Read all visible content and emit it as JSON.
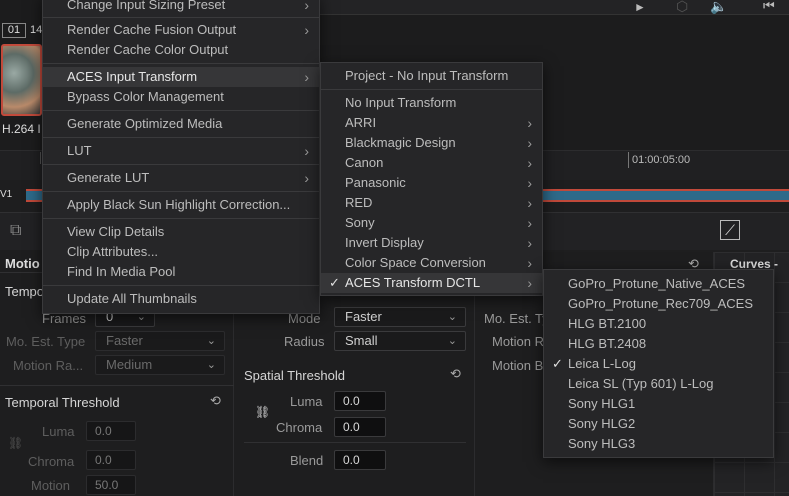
{
  "top_bar": {
    "frame_box": "01",
    "frame_box_partial": "14",
    "clip_caption": "H.264 I",
    "controls": [
      "play-icon",
      "cube-icon",
      "speaker-icon",
      "skip-back-icon"
    ]
  },
  "timeline": {
    "timecode": "01:00:05:00",
    "track_label": "V1"
  },
  "context_menu": {
    "items": [
      {
        "label": "Change Input Sizing Preset",
        "submenu": true
      },
      {
        "label": "Render Cache Fusion Output",
        "submenu": true
      },
      {
        "label": "Render Cache Color Output"
      },
      {
        "label": "ACES Input Transform",
        "submenu": true,
        "highlighted": true
      },
      {
        "label": "Bypass Color Management"
      },
      {
        "label": "Generate Optimized Media"
      },
      {
        "label": "LUT",
        "submenu": true
      },
      {
        "label": "Generate LUT",
        "submenu": true
      },
      {
        "label": "Apply Black Sun Highlight Correction..."
      },
      {
        "label": "View Clip Details"
      },
      {
        "label": "Clip Attributes..."
      },
      {
        "label": "Find In Media Pool"
      },
      {
        "label": "Update All Thumbnails"
      }
    ]
  },
  "aces_submenu": {
    "items": [
      {
        "label": "Project - No Input Transform"
      },
      {
        "label": "No Input Transform"
      },
      {
        "label": "ARRI",
        "submenu": true
      },
      {
        "label": "Blackmagic Design",
        "submenu": true
      },
      {
        "label": "Canon",
        "submenu": true
      },
      {
        "label": "Panasonic",
        "submenu": true
      },
      {
        "label": "RED",
        "submenu": true
      },
      {
        "label": "Sony",
        "submenu": true
      },
      {
        "label": "Invert Display",
        "submenu": true
      },
      {
        "label": "Color Space Conversion",
        "submenu": true
      },
      {
        "label": "ACES Transform DCTL",
        "submenu": true,
        "checked": true,
        "highlighted": true
      }
    ]
  },
  "dctl_submenu": {
    "items": [
      {
        "label": "GoPro_Protune_Native_ACES"
      },
      {
        "label": "GoPro_Protune_Rec709_ACES"
      },
      {
        "label": "HLG BT.2100"
      },
      {
        "label": "HLG BT.2408"
      },
      {
        "label": "Leica L-Log",
        "checked": true
      },
      {
        "label": "Leica SL (Typ 601) L-Log"
      },
      {
        "label": "Sony HLG1"
      },
      {
        "label": "Sony HLG2"
      },
      {
        "label": "Sony HLG3"
      }
    ]
  },
  "left_panel": {
    "title": "Motio",
    "section": "Tempo",
    "frames_label": "Frames",
    "frames_value": "0",
    "mo_est_label": "Mo. Est. Type",
    "mo_est_value": "Faster",
    "motion_range_label": "Motion Ra...",
    "motion_range_value": "Medium",
    "temporal_threshold": "Temporal Threshold",
    "luma_label": "Luma",
    "luma_value": "0.0",
    "chroma_label": "Chroma",
    "chroma_value": "0.0",
    "motion_label": "Motion",
    "motion_value": "50.0"
  },
  "mid_panel": {
    "mode_label": "Mode",
    "mode_value": "Faster",
    "radius_label": "Radius",
    "radius_value": "Small",
    "spatial_threshold": "Spatial Threshold",
    "luma_label": "Luma",
    "luma_value": "0.0",
    "chroma_label": "Chroma",
    "chroma_value": "0.0",
    "blend_label": "Blend",
    "blend_value": "0.0"
  },
  "right_panel": {
    "mo_est_label": "Mo. Est. Ty",
    "motion_r_label": "Motion R",
    "motion_b_label": "Motion B"
  },
  "curves_panel": {
    "title": "Curves - C"
  }
}
